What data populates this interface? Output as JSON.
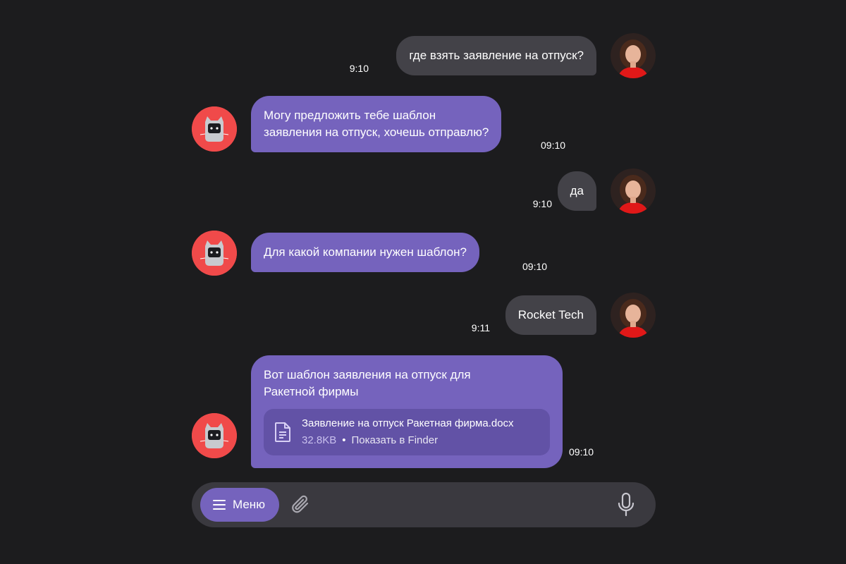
{
  "messages": [
    {
      "from": "user",
      "text": "где взять заявление на отпуск?",
      "time": "9:10"
    },
    {
      "from": "bot",
      "lines": [
        "Могу предложить тебе шаблон",
        "заявления на отпуск, хочешь отправлю?"
      ],
      "time": "09:10"
    },
    {
      "from": "user",
      "text": "да",
      "time": "9:10"
    },
    {
      "from": "bot",
      "lines": [
        "Для какой компании нужен шаблон?"
      ],
      "time": "09:10"
    },
    {
      "from": "user",
      "text": "Rocket Tech",
      "time": "9:11"
    },
    {
      "from": "bot",
      "lines": [
        "Вот шаблон заявления на отпуск для",
        "Ракетной фирмы"
      ],
      "time": "09:10",
      "file": {
        "name": "Заявление на отпуск Ракетная фирма.docx",
        "size": "32.8KB",
        "separator": "•",
        "action": "Показать в Finder"
      }
    }
  ],
  "composer": {
    "menu_label": "Меню"
  },
  "icons": {
    "menu": "hamburger-icon",
    "attach": "paperclip-icon",
    "mic": "microphone-icon",
    "file": "document-icon"
  },
  "colors": {
    "background": "#1c1c1e",
    "user_bubble": "#434248",
    "bot_bubble": "#7563bd",
    "file_card": "#6252a6",
    "bot_avatar": "#f04a4a",
    "composer": "#3a393f"
  }
}
